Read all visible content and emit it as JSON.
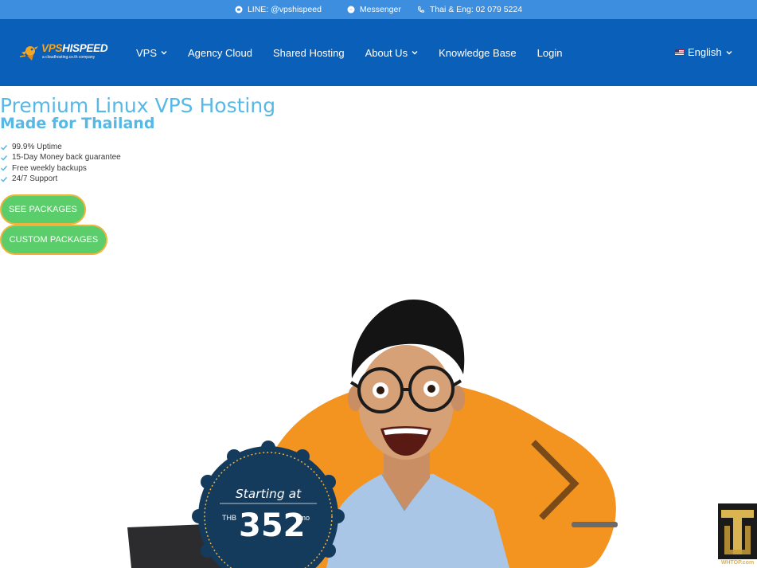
{
  "topbar": {
    "line": "LINE: @vpshispeed",
    "messenger": "Messenger",
    "phone": "Thai & Eng: 02 079 5224"
  },
  "logo": {
    "brand_part1": "VPS",
    "brand_part2": "HISPEED",
    "tagline": "a cloudhosting.co.th company"
  },
  "nav": {
    "items": [
      {
        "label": "VPS",
        "dropdown": true
      },
      {
        "label": "Agency Cloud",
        "dropdown": false
      },
      {
        "label": "Shared Hosting",
        "dropdown": false
      },
      {
        "label": "About Us",
        "dropdown": true
      },
      {
        "label": "Knowledge Base",
        "dropdown": false
      },
      {
        "label": "Login",
        "dropdown": false
      }
    ],
    "language": "English"
  },
  "hero": {
    "title": "Premium Linux VPS Hosting",
    "subtitle": "Made for Thailand",
    "features": [
      "99.9% Uptime",
      "15-Day Money back guarantee",
      "Free weekly backups",
      "24/7 Support"
    ],
    "btn_packages": "SEE PACKAGES",
    "btn_custom": "CUSTOM PACKAGES"
  },
  "badge": {
    "starting": "Starting at",
    "currency": "THB",
    "price": "352",
    "period": "/mo"
  },
  "watermark": {
    "text": "WHTOP.com"
  },
  "colors": {
    "topbar": "#3d8ede",
    "nav": "#0a5fb8",
    "heading": "#57b8e6",
    "button": "#5bcd6b",
    "button_border": "#f0b43c",
    "blob": "#f39320",
    "badge": "#143a5c"
  }
}
